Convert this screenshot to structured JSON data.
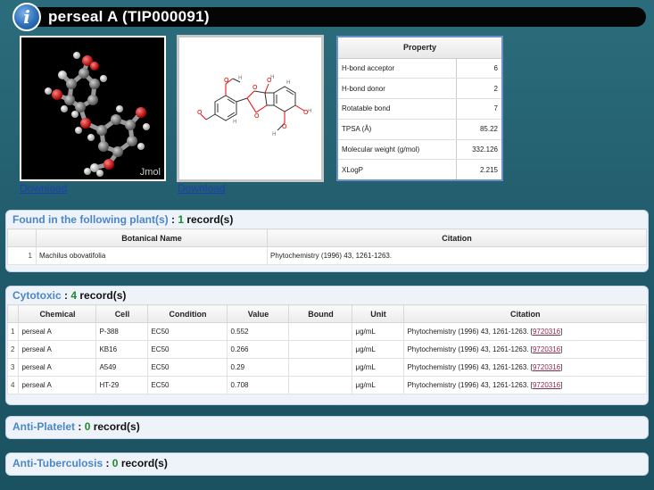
{
  "header": {
    "title": "perseal A (TIP000091)"
  },
  "images": {
    "jmol_label": "Jmol",
    "download_label": "Download"
  },
  "properties": {
    "header": "Property",
    "rows": [
      {
        "label": "H-bond acceptor",
        "value": "6"
      },
      {
        "label": "H-bond donor",
        "value": "2"
      },
      {
        "label": "Rotatable bond",
        "value": "7"
      },
      {
        "label": "TPSA (Å)",
        "value": "85.22"
      },
      {
        "label": "Molecular weight (g/mol)",
        "value": "332.126"
      },
      {
        "label": "XLogP",
        "value": "2.215"
      }
    ]
  },
  "plants": {
    "title": "Found in the following plant(s)",
    "separator": " : ",
    "count": "1",
    "records_label": " record(s)",
    "columns": [
      "",
      "Botanical Name",
      "Citation"
    ],
    "rows": [
      {
        "idx": "1",
        "name": "Machilus obovatifolia",
        "citation": "Phytochemistry (1996) 43, 1261-1263."
      }
    ]
  },
  "cytotoxic": {
    "title": "Cytotoxic",
    "separator": " : ",
    "count": "4",
    "records_label": " record(s)",
    "columns": [
      "",
      "Chemical",
      "Cell",
      "Condition",
      "Value",
      "Bound",
      "Unit",
      "Citation"
    ],
    "rows": [
      {
        "idx": "1",
        "chemical": "perseal A",
        "cell": "P-388",
        "condition": "EC50",
        "value": "0.552",
        "bound": "",
        "unit": "μg/mL",
        "citation": "Phytochemistry (1996) 43, 1261-1263. [",
        "pmid": "9720316",
        "close": "]"
      },
      {
        "idx": "2",
        "chemical": "perseal A",
        "cell": "KB16",
        "condition": "EC50",
        "value": "0.266",
        "bound": "",
        "unit": "μg/mL",
        "citation": "Phytochemistry (1996) 43, 1261-1263. [",
        "pmid": "9720316",
        "close": "]"
      },
      {
        "idx": "3",
        "chemical": "perseal A",
        "cell": "A549",
        "condition": "EC50",
        "value": "0.29",
        "bound": "",
        "unit": "μg/mL",
        "citation": "Phytochemistry (1996) 43, 1261-1263. [",
        "pmid": "9720316",
        "close": "]"
      },
      {
        "idx": "4",
        "chemical": "perseal A",
        "cell": "HT-29",
        "condition": "EC50",
        "value": "0.708",
        "bound": "",
        "unit": "μg/mL",
        "citation": "Phytochemistry (1996) 43, 1261-1263. [",
        "pmid": "9720316",
        "close": "]"
      }
    ]
  },
  "anti_platelet": {
    "title": "Anti-Platelet",
    "separator": " : ",
    "count": "0",
    "records_label": " record(s)"
  },
  "anti_tuberculosis": {
    "title": "Anti-Tuberculosis",
    "separator": " : ",
    "count": "0",
    "records_label": " record(s)"
  }
}
